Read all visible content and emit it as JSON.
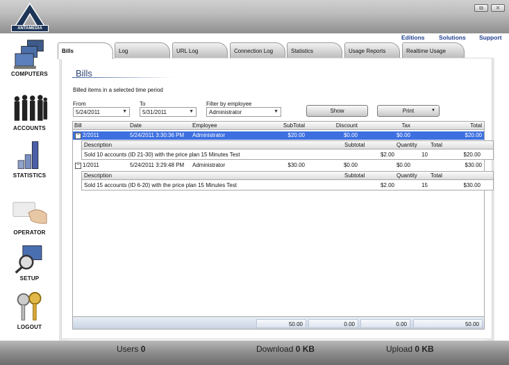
{
  "app": {
    "brand": "ANTAMEDIA"
  },
  "window_controls": {
    "restore": "⧉",
    "close": "✕"
  },
  "sidebar": {
    "items": [
      {
        "label": "COMPUTERS",
        "icon": "computers-icon"
      },
      {
        "label": "ACCOUNTS",
        "icon": "accounts-icon"
      },
      {
        "label": "STATISTICS",
        "icon": "statistics-icon"
      },
      {
        "label": "OPERATOR",
        "icon": "operator-icon"
      },
      {
        "label": "SETUP",
        "icon": "setup-icon"
      },
      {
        "label": "LOGOUT",
        "icon": "logout-keys-icon"
      }
    ]
  },
  "top_links": [
    "Editions",
    "Solutions",
    "Support"
  ],
  "tabs": [
    "Bills",
    "Log",
    "URL Log",
    "Connection Log",
    "Statistics",
    "Usage Reports",
    "Realtime Usage"
  ],
  "page": {
    "title": "Bills",
    "subtitle": "Billed items in a selected time period"
  },
  "filters": {
    "from_label": "From",
    "from_value": "5/24/2011",
    "to_label": "To",
    "to_value": "5/31/2011",
    "employee_label": "Filter by employee",
    "employee_value": "Administrator",
    "show_label": "Show",
    "print_label": "Print"
  },
  "grid": {
    "columns": [
      "Bill",
      "Date",
      "Employee",
      "SubTotal",
      "Discount",
      "Tax",
      "Total"
    ],
    "bills": [
      {
        "bill": "2/2011",
        "date": "5/24/2011 3:30:36 PM",
        "employee": "Administrator",
        "subtotal": "$20.00",
        "discount": "$0.00",
        "tax": "$0.00",
        "total": "$20.00",
        "expander": "−",
        "items": [
          {
            "description": "Sold 10 accounts (ID 21-30) with the price plan 15 Minutes Test",
            "subtotal": "$2.00",
            "quantity": "10",
            "total": "$20.00"
          }
        ]
      },
      {
        "bill": "1/2011",
        "date": "5/24/2011 3:29:48 PM",
        "employee": "Administrator",
        "subtotal": "$30.00",
        "discount": "$0.00",
        "tax": "$0.00",
        "total": "$30.00",
        "expander": "−",
        "items": [
          {
            "description": "Sold 15 accounts (ID 6-20) with the price plan 15 Minutes Test",
            "subtotal": "$2.00",
            "quantity": "15",
            "total": "$30.00"
          }
        ]
      }
    ],
    "item_columns": [
      "Description",
      "Subtotal",
      "Quantity",
      "Total"
    ],
    "footer": {
      "subtotal": "50.00",
      "discount": "0.00",
      "tax": "0.00",
      "total": "50.00"
    }
  },
  "status": {
    "users_label": "Users",
    "users_value": "0",
    "download_label": "Download",
    "download_value": "0 KB",
    "upload_label": "Upload",
    "upload_value": "0 KB"
  },
  "colors": {
    "selection": "#3d6fe0",
    "link": "#1f3f8f",
    "title": "#2a3f70"
  }
}
